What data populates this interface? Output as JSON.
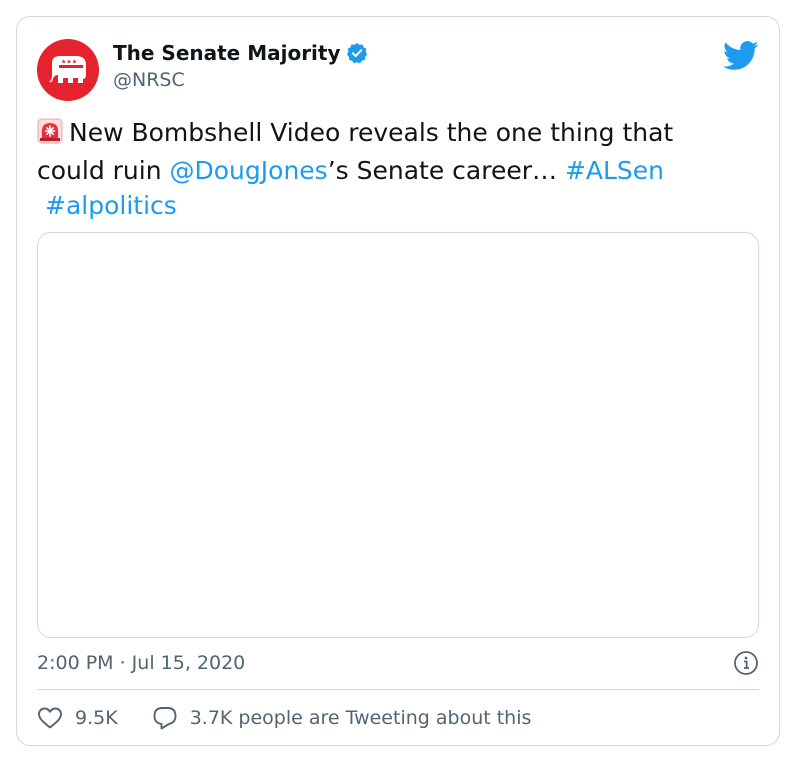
{
  "author": {
    "display_name": "The Senate Majority",
    "handle": "@NRSC",
    "verified": true,
    "avatar_color": "#e5232f"
  },
  "tweet": {
    "emoji_icon": "siren-icon",
    "text_1": "New Bombshell Video reveals the one thing that could ruin ",
    "mention": "@DougJones",
    "text_2": "’s Senate career… ",
    "hashtag_1": "#ALSen",
    "hashtag_2": "#alpolitics"
  },
  "timestamp": "2:00 PM · Jul 15, 2020",
  "actions": {
    "likes": "9.5K",
    "tweeting": "3.7K people are Tweeting about this"
  },
  "colors": {
    "link": "#1d9bf0",
    "twitter_blue": "#1d9bf0",
    "border": "#cfd9de",
    "muted": "#536471"
  }
}
